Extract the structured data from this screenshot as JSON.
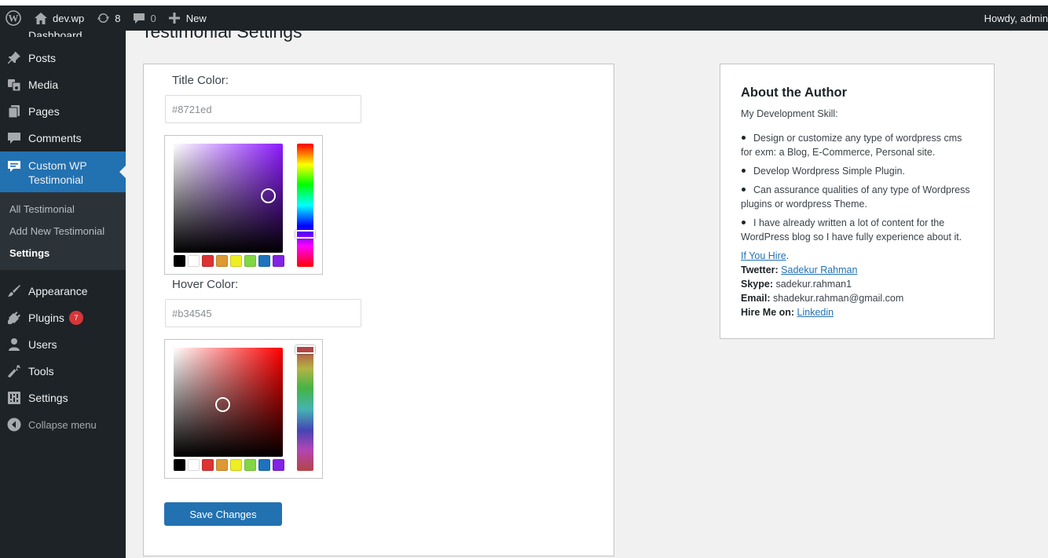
{
  "adminbar": {
    "site_name": "dev.wp",
    "updates_count": "8",
    "comments_count": "0",
    "new_label": "New",
    "howdy": "Howdy, admin"
  },
  "sidebar": {
    "cut_item": "Dashboard",
    "items": [
      {
        "label": "Posts",
        "icon": "pin-icon"
      },
      {
        "label": "Media",
        "icon": "media-icon"
      },
      {
        "label": "Pages",
        "icon": "pages-icon"
      },
      {
        "label": "Comments",
        "icon": "comment-icon"
      }
    ],
    "active": {
      "label": "Custom WP Testimonial",
      "icon": "testimonial-icon"
    },
    "submenu": [
      "All Testimonial",
      "Add New Testimonial",
      "Settings"
    ],
    "lower_items": [
      {
        "label": "Appearance",
        "icon": "brush-icon"
      },
      {
        "label": "Plugins",
        "icon": "plugin-icon",
        "badge": "7"
      },
      {
        "label": "Users",
        "icon": "users-icon"
      },
      {
        "label": "Tools",
        "icon": "wrench-icon"
      },
      {
        "label": "Settings",
        "icon": "settings-icon"
      }
    ],
    "collapse": "Collapse menu"
  },
  "page": {
    "title": "Testimonial Settings"
  },
  "settings": {
    "title_color_label": "Title Color:",
    "title_color_value": "#8721ed",
    "hover_color_label": "Hover Color:",
    "hover_color_value": "#b34545",
    "title_hue": "#8c1aff",
    "hover_hue": "#ff0000",
    "palette": [
      "#000000",
      "#ffffff",
      "#dd3333",
      "#dd9933",
      "#eeee22",
      "#81d742",
      "#1e73be",
      "#8224e3"
    ],
    "save_label": "Save Changes"
  },
  "author": {
    "heading": "About the Author",
    "skill_title": "My Development Skill:",
    "skills": [
      "Design or customize any type of wordpress cms for exm: a Blog, E-Commerce, Personal site.",
      "Develop Wordpress Simple Plugin.",
      "Can assurance qualities of any type of Wordpress plugins or wordpress Theme.",
      "I have already written a lot of content for the WordPress blog so I have fully experience about it."
    ],
    "hire_link": "If You Hire",
    "hire_suffix": ".",
    "twitter_label": "Twetter:",
    "twitter_value": "Sadekur Rahman",
    "skype_label": "Skype:",
    "skype_value": "sadekur.rahman1",
    "email_label": "Email:",
    "email_value": "shadekur.rahman@gmail.com",
    "hire_label": "Hire Me on:",
    "hire_value": "Linkedin"
  }
}
